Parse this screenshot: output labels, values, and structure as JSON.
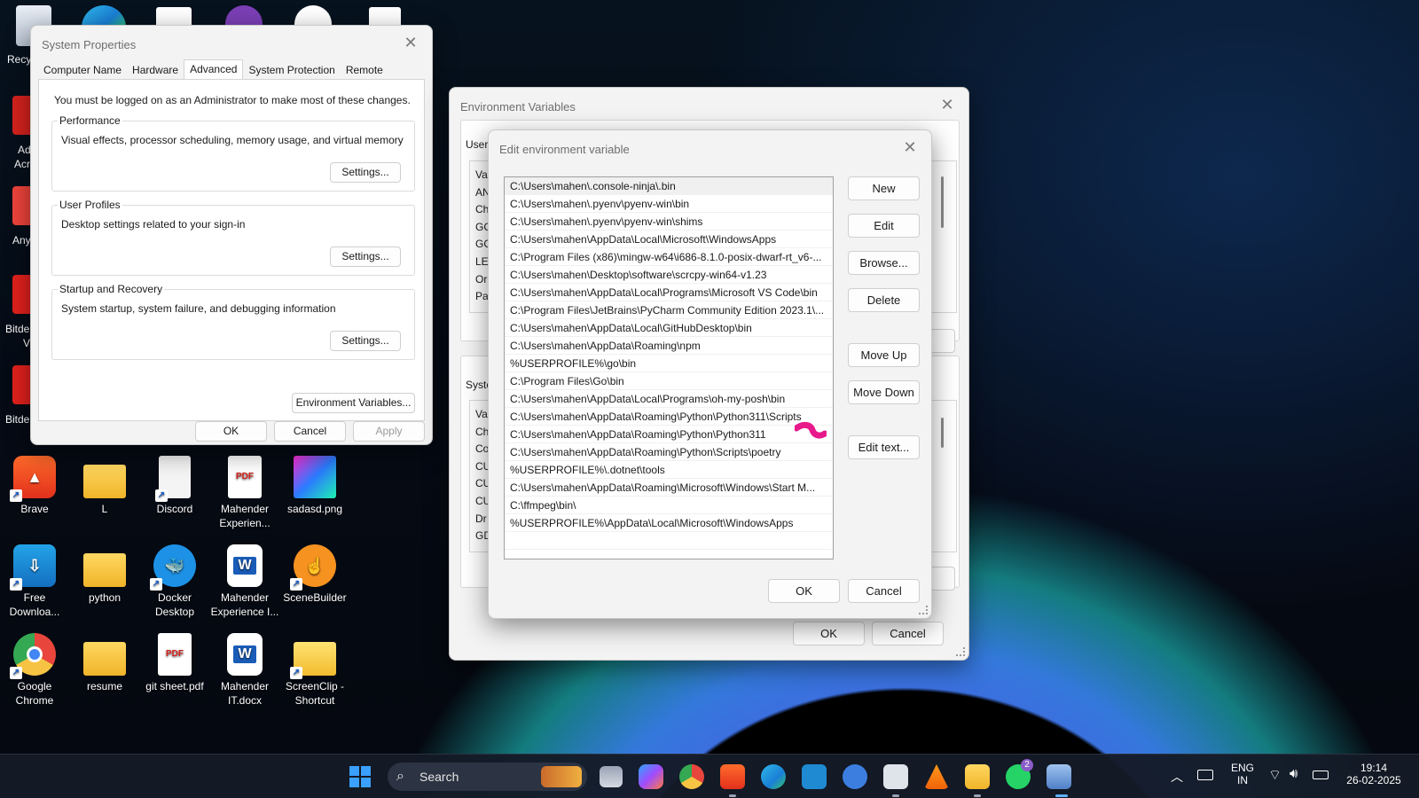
{
  "desktop": {
    "top_labels": [
      "Recy",
      "Ad",
      "Acr",
      "Any",
      "Bitde",
      "V",
      "Bitde"
    ],
    "icons": [
      {
        "label": "Brave",
        "icon": "brave-icon"
      },
      {
        "label": "L",
        "icon": "folder-icon"
      },
      {
        "label": "Discord",
        "icon": "file-icon"
      },
      {
        "label": "Mahender Experien...",
        "icon": "pdf-icon"
      },
      {
        "label": "sadasd.png",
        "icon": "image-icon"
      },
      {
        "label": "Free Downloa...",
        "icon": "download-icon"
      },
      {
        "label": "python",
        "icon": "folder-icon"
      },
      {
        "label": "Docker Desktop",
        "icon": "docker-icon"
      },
      {
        "label": "Mahender Experience I...",
        "icon": "word-icon"
      },
      {
        "label": "SceneBuilder",
        "icon": "scenebuilder-icon"
      },
      {
        "label": "Google Chrome",
        "icon": "chrome-icon"
      },
      {
        "label": "resume",
        "icon": "folder-icon"
      },
      {
        "label": "git sheet.pdf",
        "icon": "pdf-icon"
      },
      {
        "label": "Mahender IT.docx",
        "icon": "word-icon"
      },
      {
        "label": "ScreenClip - Shortcut",
        "icon": "folder-icon"
      }
    ]
  },
  "system_properties": {
    "title": "System Properties",
    "tabs": [
      "Computer Name",
      "Hardware",
      "Advanced",
      "System Protection",
      "Remote"
    ],
    "active_tab": "Advanced",
    "admin_note": "You must be logged on as an Administrator to make most of these changes.",
    "groups": [
      {
        "label": "Performance",
        "desc": "Visual effects, processor scheduling, memory usage, and virtual memory",
        "button": "Settings..."
      },
      {
        "label": "User Profiles",
        "desc": "Desktop settings related to your sign-in",
        "button": "Settings..."
      },
      {
        "label": "Startup and Recovery",
        "desc": "System startup, system failure, and debugging information",
        "button": "Settings..."
      }
    ],
    "env_button": "Environment Variables...",
    "ok": "OK",
    "cancel": "Cancel",
    "apply": "Apply"
  },
  "environment_variables": {
    "title": "Environment Variables",
    "user_label": "User",
    "user_rows": [
      "Va",
      "AN",
      "Ch",
      "GC",
      "GC",
      "LE",
      "Or",
      "Pa"
    ],
    "system_label": "Syste",
    "system_rows": [
      "Va",
      "Ch",
      "Co",
      "CU",
      "CU",
      "CU",
      "Dr",
      "GD"
    ],
    "ok": "OK",
    "cancel": "Cancel"
  },
  "edit_variable": {
    "title": "Edit environment variable",
    "entries": [
      "C:\\Users\\mahen\\.console-ninja\\.bin",
      "C:\\Users\\mahen\\.pyenv\\pyenv-win\\bin",
      "C:\\Users\\mahen\\.pyenv\\pyenv-win\\shims",
      "C:\\Users\\mahen\\AppData\\Local\\Microsoft\\WindowsApps",
      "C:\\Program Files (x86)\\mingw-w64\\i686-8.1.0-posix-dwarf-rt_v6-...",
      "C:\\Users\\mahen\\Desktop\\software\\scrcpy-win64-v1.23",
      "C:\\Users\\mahen\\AppData\\Local\\Programs\\Microsoft VS Code\\bin",
      "C:\\Program Files\\JetBrains\\PyCharm Community Edition 2023.1\\...",
      "C:\\Users\\mahen\\AppData\\Local\\GitHubDesktop\\bin",
      "C:\\Users\\mahen\\AppData\\Roaming\\npm",
      "%USERPROFILE%\\go\\bin",
      "C:\\Program Files\\Go\\bin",
      "C:\\Users\\mahen\\AppData\\Local\\Programs\\oh-my-posh\\bin",
      "C:\\Users\\mahen\\AppData\\Roaming\\Python\\Python311\\Scripts",
      "C:\\Users\\mahen\\AppData\\Roaming\\Python\\Python311",
      "C:\\Users\\mahen\\AppData\\Roaming\\Python\\Scripts\\poetry",
      "%USERPROFILE%\\.dotnet\\tools",
      "C:\\Users\\mahen\\AppData\\Roaming\\Microsoft\\Windows\\Start M...",
      "C:\\ffmpeg\\bin\\",
      "%USERPROFILE%\\AppData\\Local\\Microsoft\\WindowsApps"
    ],
    "buttons": {
      "new": "New",
      "edit": "Edit",
      "browse": "Browse...",
      "delete": "Delete",
      "move_up": "Move Up",
      "move_down": "Move Down",
      "edit_text": "Edit text..."
    },
    "ok": "OK",
    "cancel": "Cancel"
  },
  "taskbar": {
    "search_placeholder": "Search",
    "lang": "ENG",
    "region": "IN",
    "time": "19:14",
    "date": "26-02-2025",
    "whatsapp_badge": "2"
  }
}
